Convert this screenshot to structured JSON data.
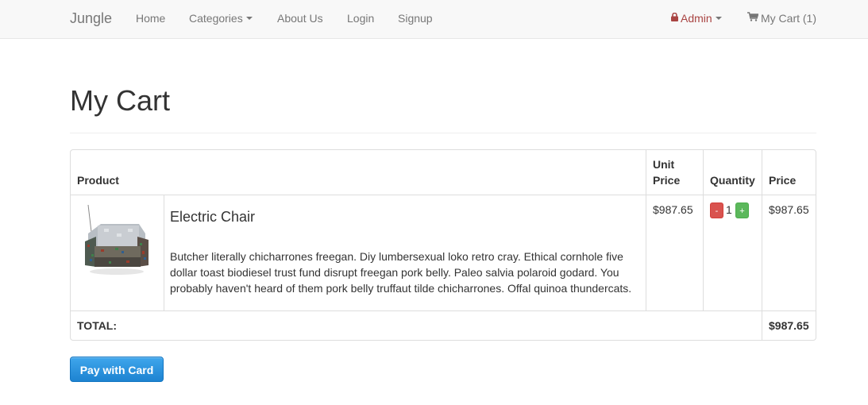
{
  "navbar": {
    "brand": "Jungle",
    "links": {
      "home": "Home",
      "categories": "Categories",
      "about": "About Us",
      "login": "Login",
      "signup": "Signup"
    },
    "admin": "Admin",
    "cart": "My Cart (1)",
    "icons": {
      "admin": "lock-icon",
      "cart": "shopping-cart-icon"
    },
    "colors": {
      "admin": "#a94442",
      "link": "#777777",
      "background": "#f8f8f8"
    }
  },
  "page": {
    "title": "My Cart"
  },
  "table": {
    "headers": {
      "product": "Product",
      "unit_price_line1": "Unit",
      "unit_price_line2": "Price",
      "quantity": "Quantity",
      "price": "Price"
    },
    "rows": [
      {
        "name": "Electric Chair",
        "description": "Butcher literally chicharrones freegan. Diy lumbersexual loko retro cray. Ethical cornhole five dollar toast biodiesel trust fund disrupt freegan pork belly. Paleo salvia polaroid godard. You probably haven't heard of them pork belly truffaut tilde chicharrones. Offal quinoa thundercats.",
        "unit_price": "$987.65",
        "quantity": "1",
        "minus_label": "-",
        "plus_label": "+",
        "price": "$987.65"
      }
    ],
    "total_label": "TOTAL:",
    "total_value": "$987.65"
  },
  "actions": {
    "pay": "Pay with Card"
  },
  "colors": {
    "pay_button": "#1d83d1",
    "minus": "#d9534f",
    "plus": "#5cb85c"
  }
}
